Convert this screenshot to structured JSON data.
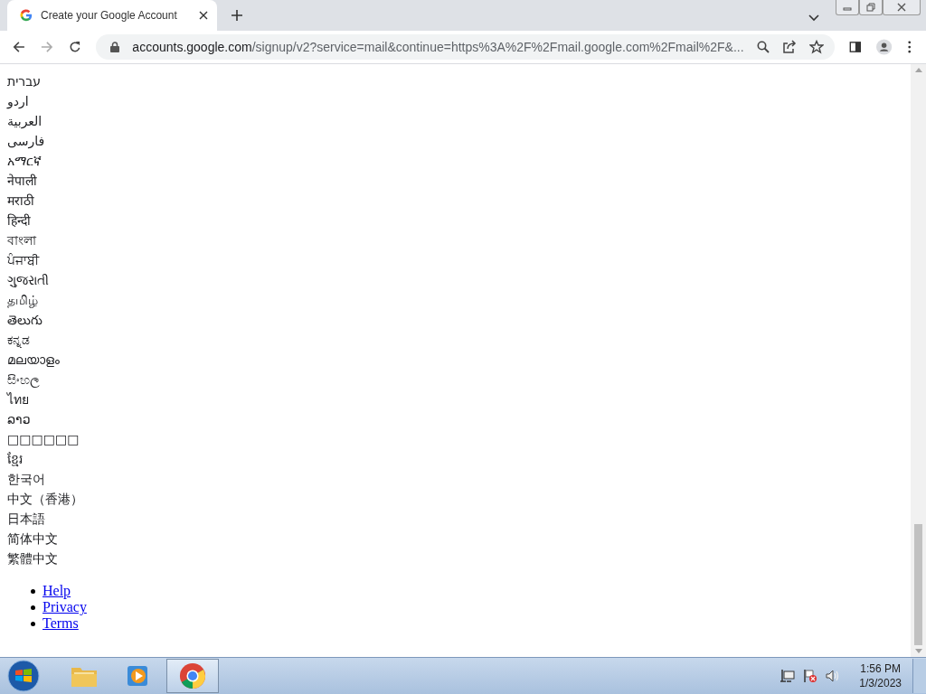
{
  "browser": {
    "tab": {
      "title": "Create your Google Account",
      "selected": true
    },
    "url_host": "accounts.google.com",
    "url_path": "/signup/v2?service=mail&continue=https%3A%2F%2Fmail.google.com%2Fmail%2F&..."
  },
  "languages": [
    "עברית",
    "اردو",
    "العربية",
    "فارسی",
    "አማርኛ",
    "नेपाली",
    "मराठी",
    "हिन्दी",
    "বাংলা",
    "ਪੰਜਾਬੀ",
    "ગુજરાતી",
    "தமிழ்",
    "తెలుగు",
    "ಕನ್ನಡ",
    "മലയാളം",
    "සිංහල",
    "ไทย",
    "ລາວ",
    "□□□□□□",
    "ខ្មែរ",
    "한국어",
    "中文（香港）",
    "日本語",
    "简体中文",
    "繁體中文"
  ],
  "footer_links": [
    "Help",
    "Privacy",
    "Terms"
  ],
  "taskbar": {
    "apps": [
      {
        "kind": "folder",
        "selected": false
      },
      {
        "kind": "media",
        "selected": false
      },
      {
        "kind": "chrome",
        "selected": true
      }
    ],
    "time": "1:56 PM",
    "date": "1/3/2023"
  }
}
